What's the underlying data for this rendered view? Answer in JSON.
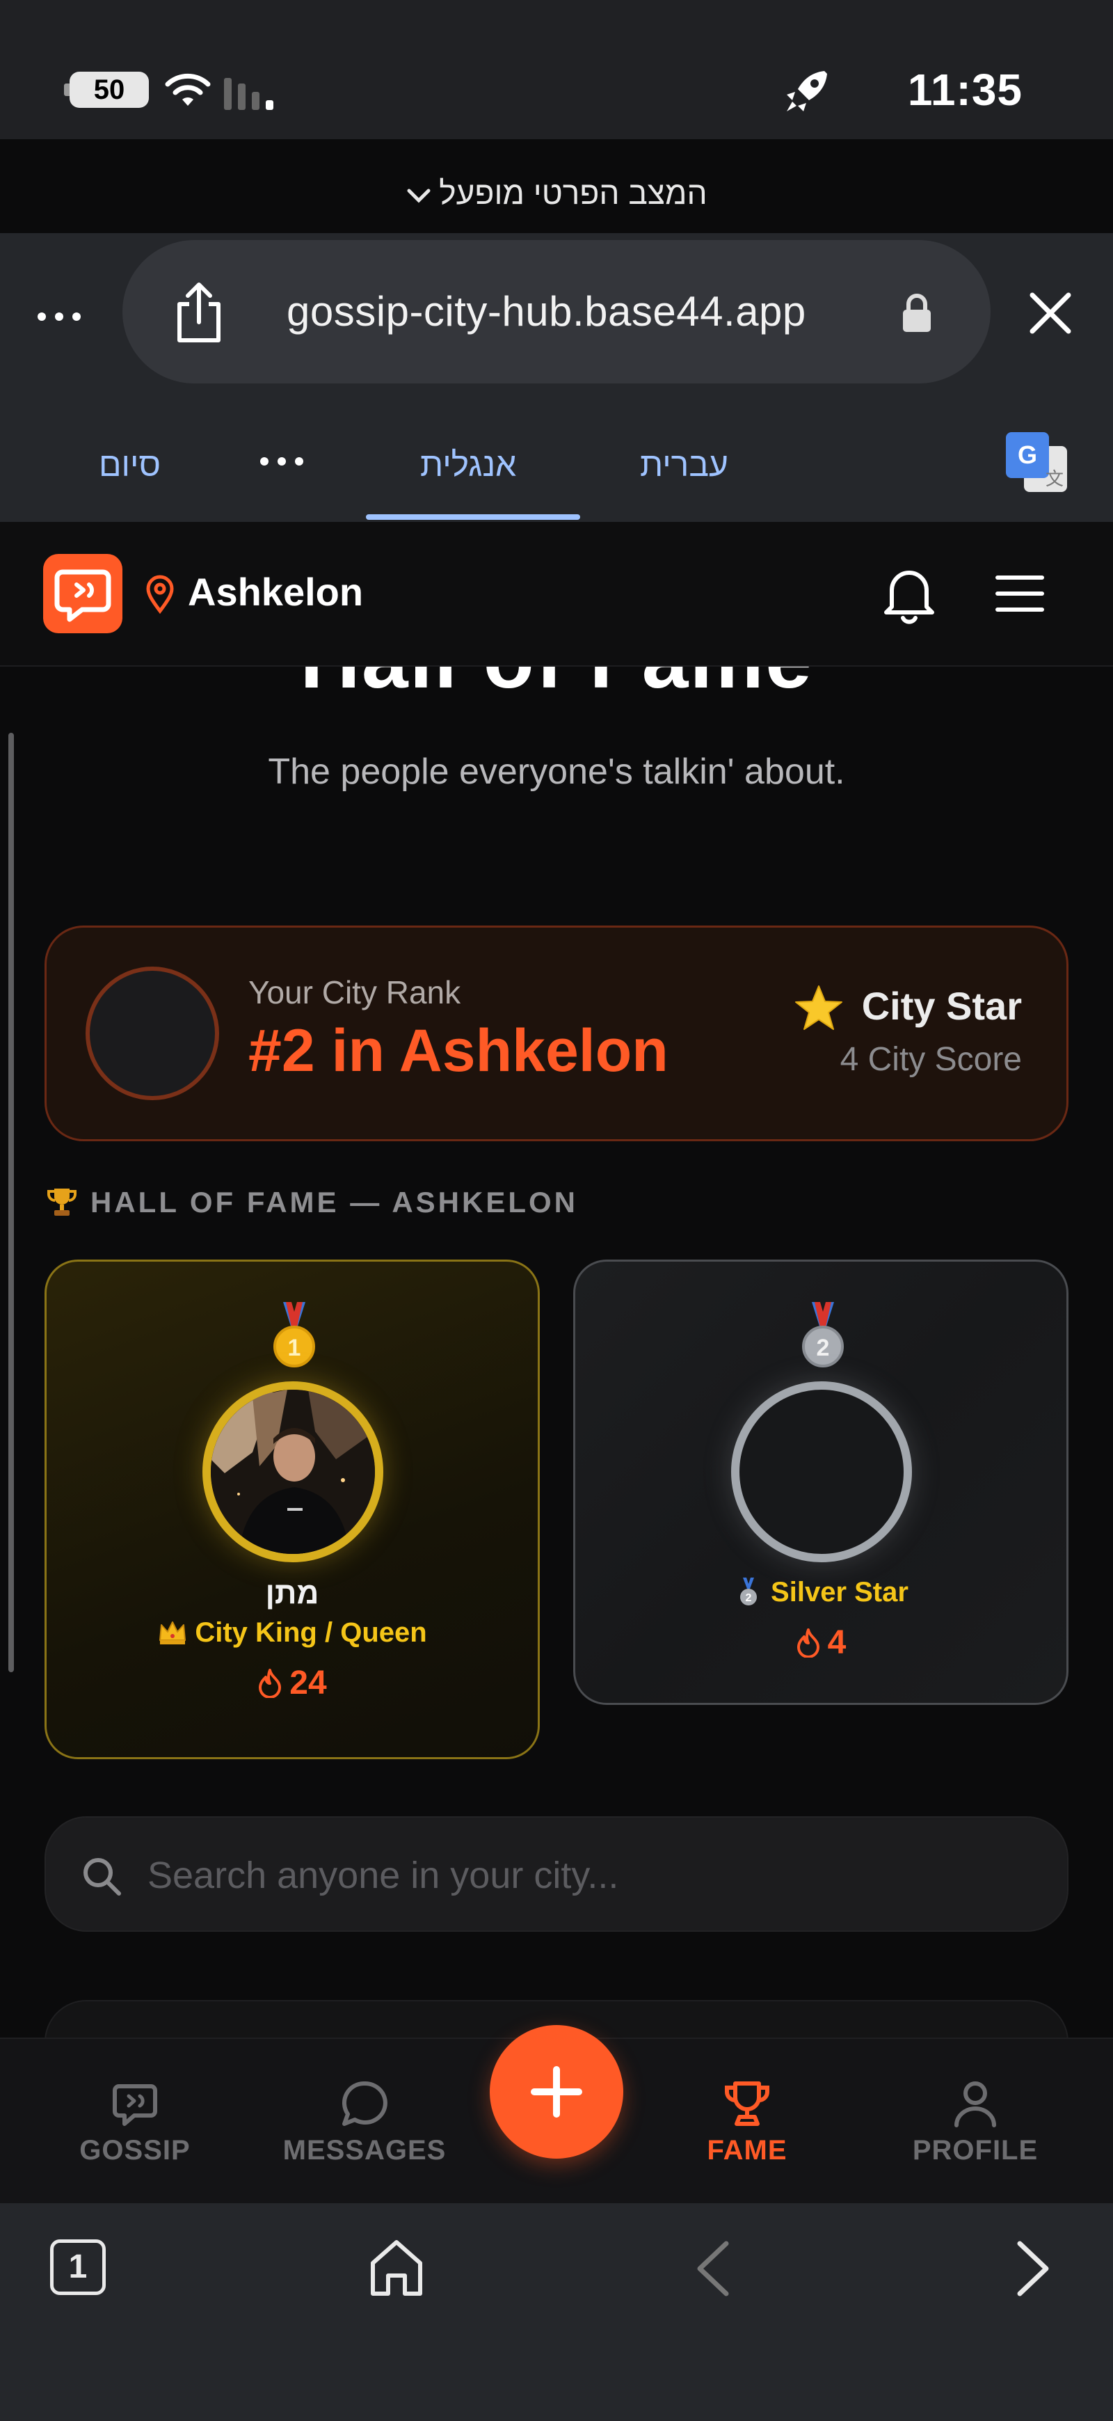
{
  "status_bar": {
    "battery": "50",
    "time": "11:35",
    "icons": [
      "battery-icon",
      "wifi-icon",
      "signal-icon",
      "rocket-icon"
    ]
  },
  "browser": {
    "private_mode_label": "המצב הפרטי מופעל",
    "url": "gossip-city-hub.base44.app",
    "tab_count": "1",
    "icons": [
      "more-icon",
      "share-icon",
      "lock-icon",
      "close-icon",
      "home-icon",
      "back-icon",
      "forward-icon"
    ]
  },
  "translate_bar": {
    "finish_label": "סיום",
    "english_label": "אנגלית",
    "hebrew_label": "עברית",
    "active": "english"
  },
  "app_header": {
    "city": "Ashkelon",
    "icons": [
      "app-logo-icon",
      "location-pin-icon",
      "bell-icon",
      "menu-icon"
    ]
  },
  "hall_of_fame": {
    "title": "Hall of Fame",
    "subtitle": "The people everyone's talkin' about."
  },
  "rank_card": {
    "label": "Your City Rank",
    "value": "#2 in Ashkelon",
    "badge": "City Star",
    "score": "4 City Score"
  },
  "section_header": "HALL OF FAME — ASHKELON",
  "fame_cards": [
    {
      "place": 1,
      "name": "מתן",
      "title": "City King / Queen",
      "score": "24"
    },
    {
      "place": 2,
      "name": "",
      "title": "Silver Star",
      "score": "4"
    }
  ],
  "search": {
    "placeholder": "Search anyone in your city...",
    "value": ""
  },
  "bottom_nav": {
    "items": [
      {
        "label": "GOSSIP"
      },
      {
        "label": "MESSAGES"
      },
      {
        "label": "FAME"
      },
      {
        "label": "PROFILE"
      }
    ],
    "active": "FAME"
  },
  "colors": {
    "accent": "#ff5a26",
    "gold": "#d7ae1d",
    "silver": "#a2a7ad",
    "title_gold": "#f5c518",
    "translate_blue": "#9fc3ff"
  }
}
